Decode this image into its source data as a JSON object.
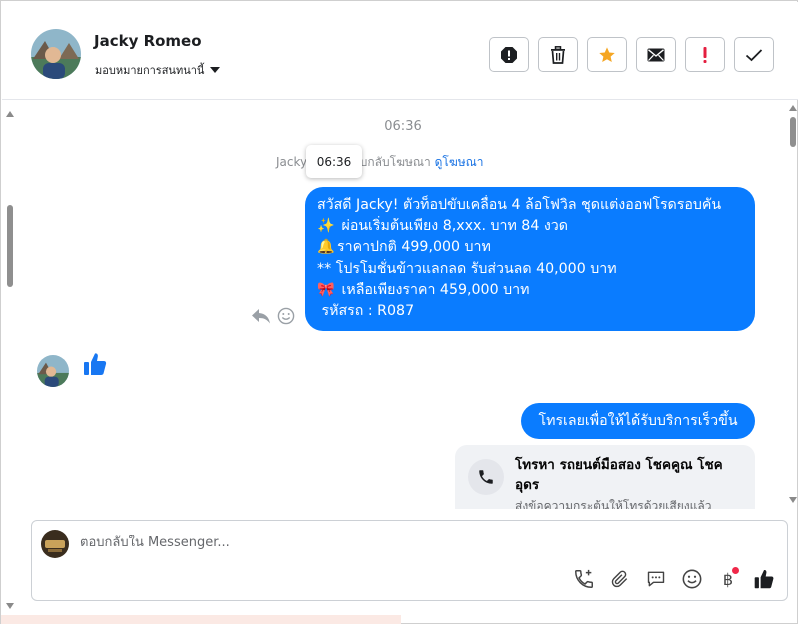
{
  "header": {
    "contact_name": "Jacky Romeo",
    "assign_label": "มอบหมายการสนทนานี้"
  },
  "thread": {
    "timestamp": "06:36",
    "tooltip_time": "06:36",
    "reply_note_prefix": "Jacky",
    "reply_note_middle": "ตอบกลับโฆษณา",
    "reply_note_link": "ดูโฆษณา",
    "ad_message_lines": [
      "สวัสดี Jacky! ตัวท็อปขับเคลื่อน 4 ล้อโฟวิล ชุดแต่งออฟโรดรอบคัน",
      "ผ่อนเริ่มต้นเพียง 8,xxx. บาท 84 งวด",
      "ราคาปกติ 499,000 บาท",
      "** โปรโมชั่นข้าวแลกลด รับส่วนลด 40,000 บาท",
      " เหลือเพียงราคา 459,000 บาท",
      "รหัสรถ : R087"
    ],
    "line_emojis": [
      "",
      "✨",
      "🔔",
      "",
      "🎀",
      ""
    ],
    "cta_message": "โทรเลยเพื่อให้ได้รับบริการเร็วขึ้น",
    "call_card": {
      "title": "โทรหา รถยนต์มือสอง โชคคูณ โชค อุดร",
      "subtitle": "ส่งข้อความกระตุ้นให้โทรด้วยเสียงแล้ว"
    }
  },
  "composer": {
    "placeholder": "ตอบกลับใน Messenger...",
    "value": "",
    "baht_symbol": "฿"
  },
  "colors": {
    "bubble_blue": "#0a7cff",
    "link_blue": "#1b74e4",
    "star_orange": "#f5a623",
    "alert_red": "#e41e3f"
  },
  "icons": {
    "header_actions": [
      "spam-icon",
      "trash-icon",
      "star-icon",
      "mail-icon",
      "exclamation-icon",
      "check-icon"
    ],
    "composer_tools": [
      "phone-add-icon",
      "attachment-icon",
      "saved-reply-icon",
      "emoji-icon",
      "baht-icon",
      "thumbs-up-icon"
    ]
  }
}
